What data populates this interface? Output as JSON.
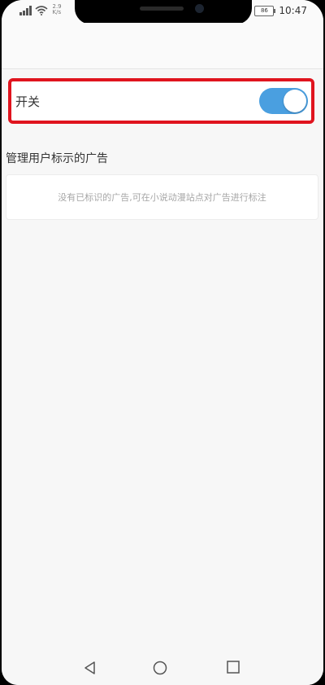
{
  "status_bar": {
    "net_speed_value": "2.9",
    "net_speed_unit": "K/s",
    "battery": "86",
    "time": "10:47",
    "icons": [
      "signal-icon",
      "wifi-icon",
      "battery-icon"
    ]
  },
  "settings": {
    "switch_label": "开关",
    "switch_on": true,
    "section_title": "管理用户标示的广告",
    "empty_message": "没有已标识的广告,可在小说动漫站点对广告进行标注"
  },
  "nav_bar": {
    "icons": [
      "back-icon",
      "home-icon",
      "recent-apps-icon"
    ]
  },
  "colors": {
    "toggle_on": "#4a9fe0",
    "highlight_border": "#e0141e"
  }
}
